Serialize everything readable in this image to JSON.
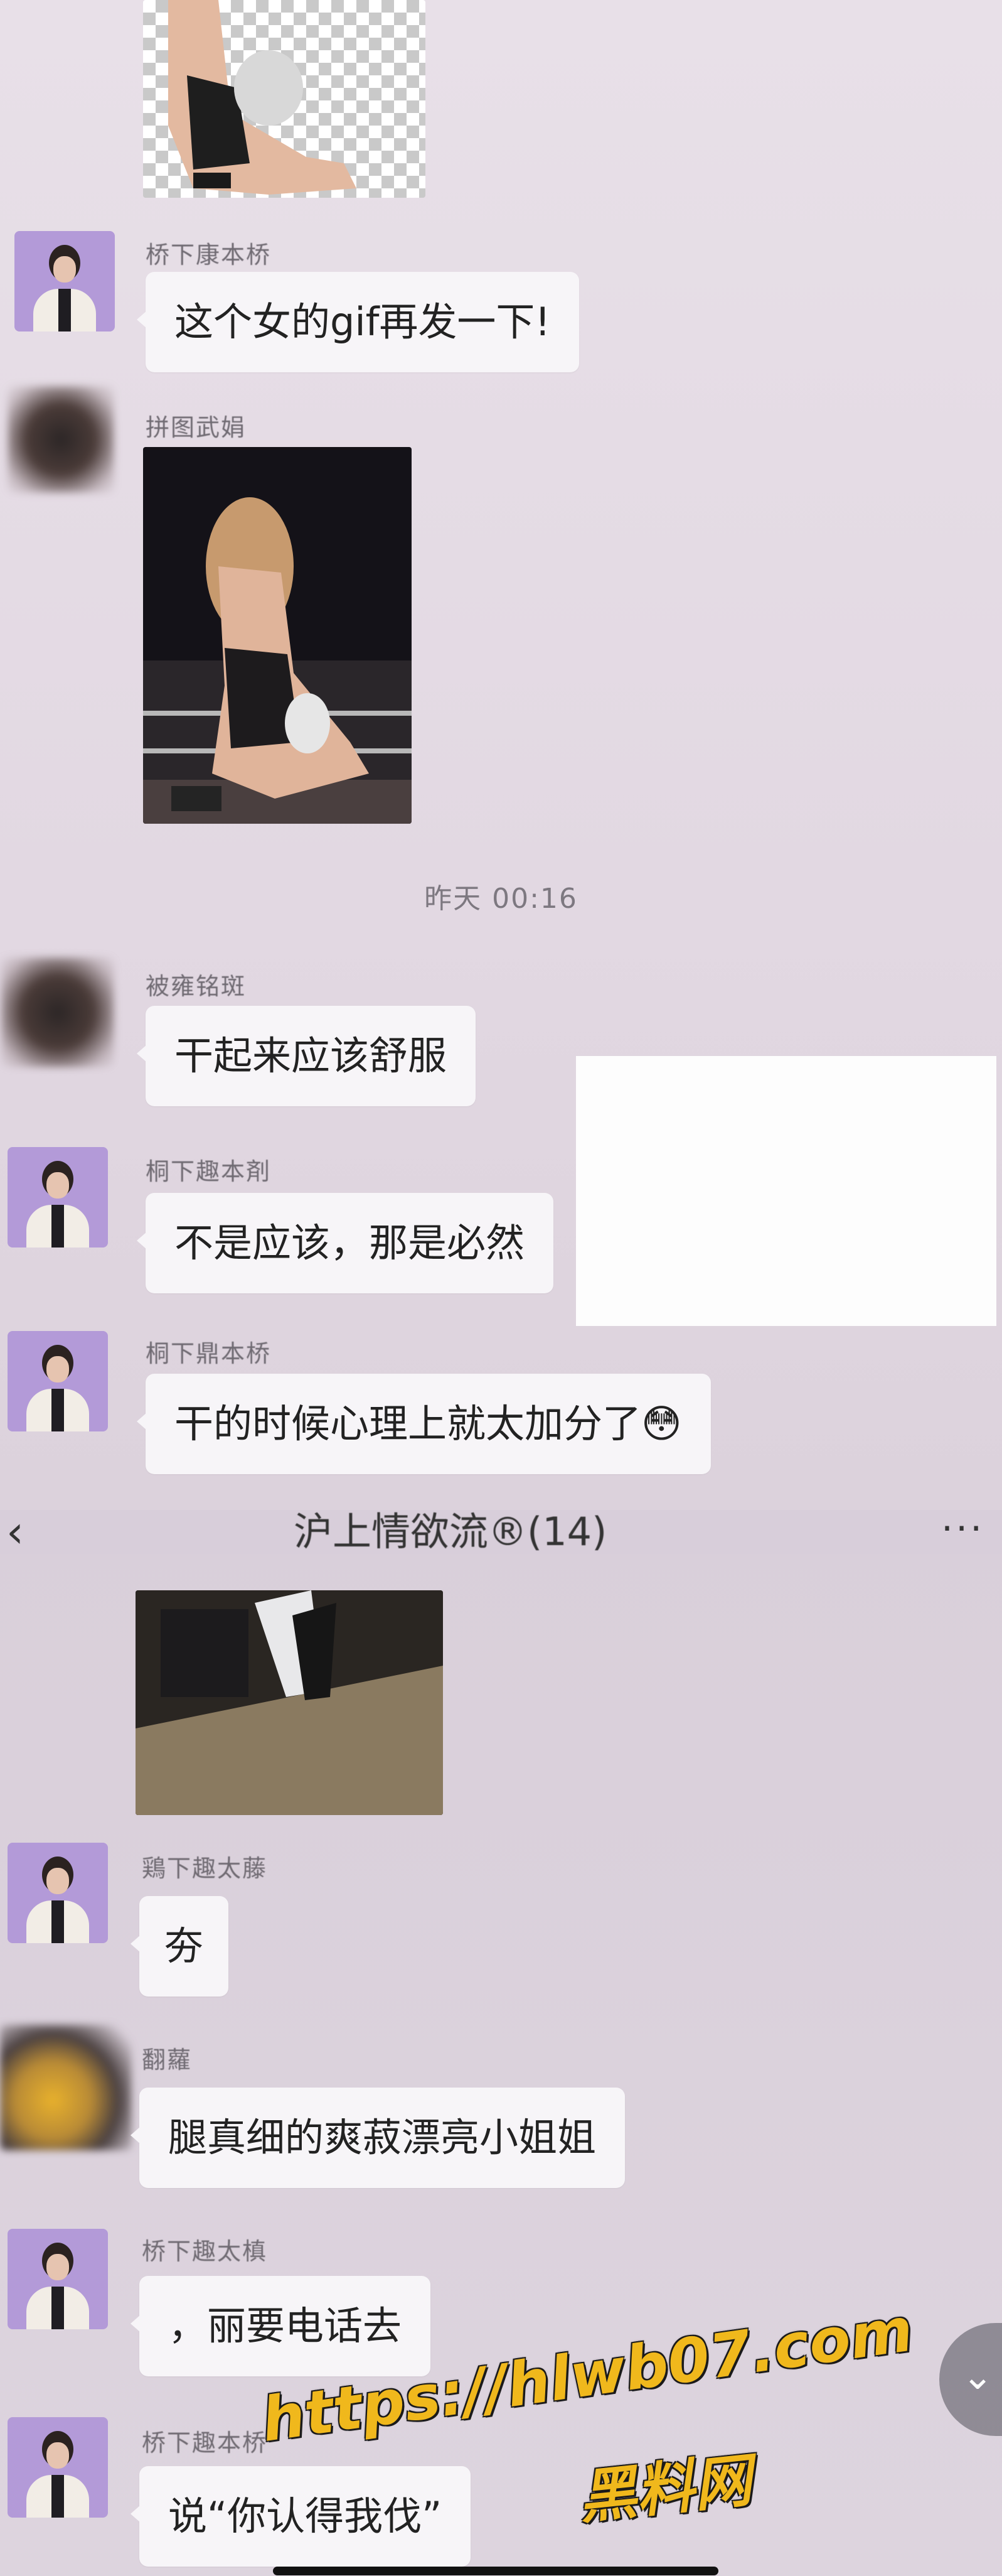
{
  "timestamp": "昨天 00:16",
  "chat_header": {
    "back_icon": "chevron-left-icon",
    "title": "沪上情欲流®(14)",
    "more_icon": "ellipsis-icon"
  },
  "messages_top": [
    {
      "name": "桥下康本桥",
      "text": "这个女的gif再发一下!"
    },
    {
      "name": "拼图武娟",
      "text": ""
    },
    {
      "name": "被雍铭斑",
      "text": "干起来应该舒服"
    },
    {
      "name": "桐下趣本剤",
      "text": "不是应该，那是必然"
    },
    {
      "name": "桐下鼎本桥",
      "text": "干的时候心理上就太加分了",
      "emoji": "😳"
    }
  ],
  "messages_bottom": [
    {
      "name": "鶏下趣太藤",
      "text": "夯"
    },
    {
      "name": "翻蘿",
      "text": "腿真细的爽菽漂亮小姐姐"
    },
    {
      "name": "桥下趣太槙",
      "text": "，丽要电话去"
    },
    {
      "name": "桥下趣本桥",
      "text": "说“你认得我伐”"
    }
  ],
  "watermark": {
    "url": "https://hlwb07.com",
    "brand": "黑料网"
  },
  "colors": {
    "bubble": "#f7f5f8",
    "watermark": "#f0b81c",
    "avatar_bg": "#b39ad8"
  }
}
